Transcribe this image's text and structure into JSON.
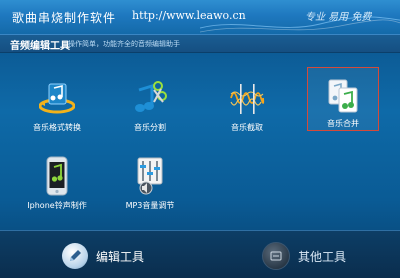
{
  "window": {
    "title": "歌曲串烧制作软件",
    "url": "http://www.leawo.cn",
    "slogan": "专业 易用 免费"
  },
  "section": {
    "title": "音频编辑工具",
    "hint": "操作简单，功能齐全的音频编辑助手"
  },
  "tools": [
    {
      "label": "音乐格式转换",
      "icon": "music-convert-icon"
    },
    {
      "label": "音乐分割",
      "icon": "music-split-icon"
    },
    {
      "label": "音乐截取",
      "icon": "music-cut-icon"
    },
    {
      "label": "音乐合并",
      "icon": "music-merge-icon",
      "selected": true
    },
    {
      "label": "Iphone铃声制作",
      "icon": "iphone-ringtone-icon"
    },
    {
      "label": "MP3音量调节",
      "icon": "volume-adjust-icon"
    }
  ],
  "bottom_tabs": [
    {
      "label": "编辑工具",
      "active": true,
      "icon": "edit-pen-icon"
    },
    {
      "label": "其他工具",
      "active": false,
      "icon": "tools-icon"
    }
  ],
  "colors": {
    "background": "#0e6aa8",
    "titlebar": "#1e78bf",
    "selection_border": "#d44a3a",
    "bottombar": "#0a2d4d"
  }
}
